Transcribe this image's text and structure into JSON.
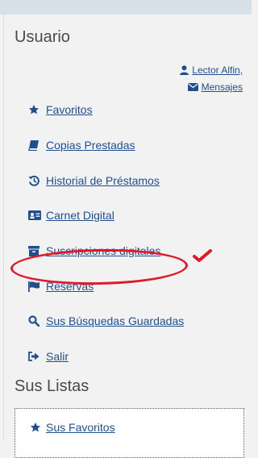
{
  "user_section": {
    "heading": "Usuario",
    "user_name": "Lector Alfin,",
    "messages": "Mensajes"
  },
  "menu": {
    "items": [
      {
        "label": "Favoritos",
        "icon": "star-icon"
      },
      {
        "label": "Copias Prestadas",
        "icon": "book-icon"
      },
      {
        "label": "Historial de Préstamos",
        "icon": "history-icon"
      },
      {
        "label": "Carnet Digital",
        "icon": "id-card-icon"
      },
      {
        "label": "Suscripciones digitales",
        "icon": "archive-box-icon"
      },
      {
        "label": "Reservas",
        "icon": "flag-icon"
      },
      {
        "label": "Sus Búsquedas Guardadas",
        "icon": "search-icon"
      },
      {
        "label": "Salir",
        "icon": "sign-out-icon"
      }
    ]
  },
  "lists_section": {
    "heading": "Sus Listas",
    "items": [
      {
        "label": "Sus Favoritos",
        "icon": "star-icon"
      }
    ]
  },
  "annotation": {
    "highlighted_item": "Suscripciones digitales",
    "circle_color": "#e0192a",
    "mark": "checkmark"
  },
  "colors": {
    "link": "#1f4f8f",
    "heading": "#4a4a4a",
    "panel": "#f2f2f2",
    "topbar": "#d8e0e8"
  }
}
